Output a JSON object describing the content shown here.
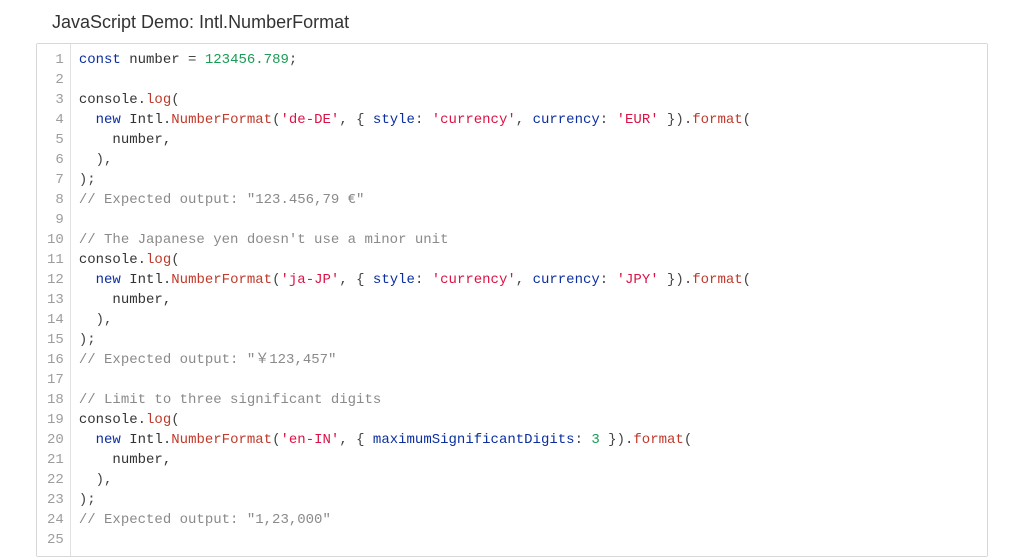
{
  "title": "JavaScript Demo: Intl.NumberFormat",
  "gutter_start": 1,
  "gutter_end": 25,
  "code": {
    "lines": [
      [
        {
          "t": "const",
          "c": "tk-key"
        },
        {
          "t": " number ",
          "c": "tk-ident"
        },
        {
          "t": "=",
          "c": "tk-op"
        },
        {
          "t": " ",
          "c": ""
        },
        {
          "t": "123456.789",
          "c": "tk-num"
        },
        {
          "t": ";",
          "c": "tk-punct"
        }
      ],
      [],
      [
        {
          "t": "console",
          "c": "tk-ident"
        },
        {
          "t": ".",
          "c": "tk-punct"
        },
        {
          "t": "log",
          "c": "tk-func"
        },
        {
          "t": "(",
          "c": "tk-punct"
        }
      ],
      [
        {
          "t": "  ",
          "c": ""
        },
        {
          "t": "new",
          "c": "tk-key"
        },
        {
          "t": " Intl",
          "c": "tk-intl"
        },
        {
          "t": ".",
          "c": "tk-punct"
        },
        {
          "t": "NumberFormat",
          "c": "tk-func"
        },
        {
          "t": "(",
          "c": "tk-punct"
        },
        {
          "t": "'de-DE'",
          "c": "tk-str"
        },
        {
          "t": ", { ",
          "c": "tk-punct"
        },
        {
          "t": "style",
          "c": "tk-key"
        },
        {
          "t": ": ",
          "c": "tk-punct"
        },
        {
          "t": "'currency'",
          "c": "tk-str"
        },
        {
          "t": ", ",
          "c": "tk-punct"
        },
        {
          "t": "currency",
          "c": "tk-key"
        },
        {
          "t": ": ",
          "c": "tk-punct"
        },
        {
          "t": "'EUR'",
          "c": "tk-str"
        },
        {
          "t": " }).",
          "c": "tk-punct"
        },
        {
          "t": "format",
          "c": "tk-func"
        },
        {
          "t": "(",
          "c": "tk-punct"
        }
      ],
      [
        {
          "t": "    number,",
          "c": "tk-ident"
        }
      ],
      [
        {
          "t": "  ),",
          "c": "tk-punct"
        }
      ],
      [
        {
          "t": ");",
          "c": "tk-punct"
        }
      ],
      [
        {
          "t": "// Expected output: \"123.456,79 €\"",
          "c": "tk-comment"
        }
      ],
      [],
      [
        {
          "t": "// The Japanese yen doesn't use a minor unit",
          "c": "tk-comment"
        }
      ],
      [
        {
          "t": "console",
          "c": "tk-ident"
        },
        {
          "t": ".",
          "c": "tk-punct"
        },
        {
          "t": "log",
          "c": "tk-func"
        },
        {
          "t": "(",
          "c": "tk-punct"
        }
      ],
      [
        {
          "t": "  ",
          "c": ""
        },
        {
          "t": "new",
          "c": "tk-key"
        },
        {
          "t": " Intl",
          "c": "tk-intl"
        },
        {
          "t": ".",
          "c": "tk-punct"
        },
        {
          "t": "NumberFormat",
          "c": "tk-func"
        },
        {
          "t": "(",
          "c": "tk-punct"
        },
        {
          "t": "'ja-JP'",
          "c": "tk-str"
        },
        {
          "t": ", { ",
          "c": "tk-punct"
        },
        {
          "t": "style",
          "c": "tk-key"
        },
        {
          "t": ": ",
          "c": "tk-punct"
        },
        {
          "t": "'currency'",
          "c": "tk-str"
        },
        {
          "t": ", ",
          "c": "tk-punct"
        },
        {
          "t": "currency",
          "c": "tk-key"
        },
        {
          "t": ": ",
          "c": "tk-punct"
        },
        {
          "t": "'JPY'",
          "c": "tk-str"
        },
        {
          "t": " }).",
          "c": "tk-punct"
        },
        {
          "t": "format",
          "c": "tk-func"
        },
        {
          "t": "(",
          "c": "tk-punct"
        }
      ],
      [
        {
          "t": "    number,",
          "c": "tk-ident"
        }
      ],
      [
        {
          "t": "  ),",
          "c": "tk-punct"
        }
      ],
      [
        {
          "t": ");",
          "c": "tk-punct"
        }
      ],
      [
        {
          "t": "// Expected output: \"￥123,457\"",
          "c": "tk-comment"
        }
      ],
      [],
      [
        {
          "t": "// Limit to three significant digits",
          "c": "tk-comment"
        }
      ],
      [
        {
          "t": "console",
          "c": "tk-ident"
        },
        {
          "t": ".",
          "c": "tk-punct"
        },
        {
          "t": "log",
          "c": "tk-func"
        },
        {
          "t": "(",
          "c": "tk-punct"
        }
      ],
      [
        {
          "t": "  ",
          "c": ""
        },
        {
          "t": "new",
          "c": "tk-key"
        },
        {
          "t": " Intl",
          "c": "tk-intl"
        },
        {
          "t": ".",
          "c": "tk-punct"
        },
        {
          "t": "NumberFormat",
          "c": "tk-func"
        },
        {
          "t": "(",
          "c": "tk-punct"
        },
        {
          "t": "'en-IN'",
          "c": "tk-str"
        },
        {
          "t": ", { ",
          "c": "tk-punct"
        },
        {
          "t": "maximumSignificantDigits",
          "c": "tk-key"
        },
        {
          "t": ": ",
          "c": "tk-punct"
        },
        {
          "t": "3",
          "c": "tk-num"
        },
        {
          "t": " }).",
          "c": "tk-punct"
        },
        {
          "t": "format",
          "c": "tk-func"
        },
        {
          "t": "(",
          "c": "tk-punct"
        }
      ],
      [
        {
          "t": "    number,",
          "c": "tk-ident"
        }
      ],
      [
        {
          "t": "  ),",
          "c": "tk-punct"
        }
      ],
      [
        {
          "t": ");",
          "c": "tk-punct"
        }
      ],
      [
        {
          "t": "// Expected output: \"1,23,000\"",
          "c": "tk-comment"
        }
      ],
      []
    ]
  }
}
